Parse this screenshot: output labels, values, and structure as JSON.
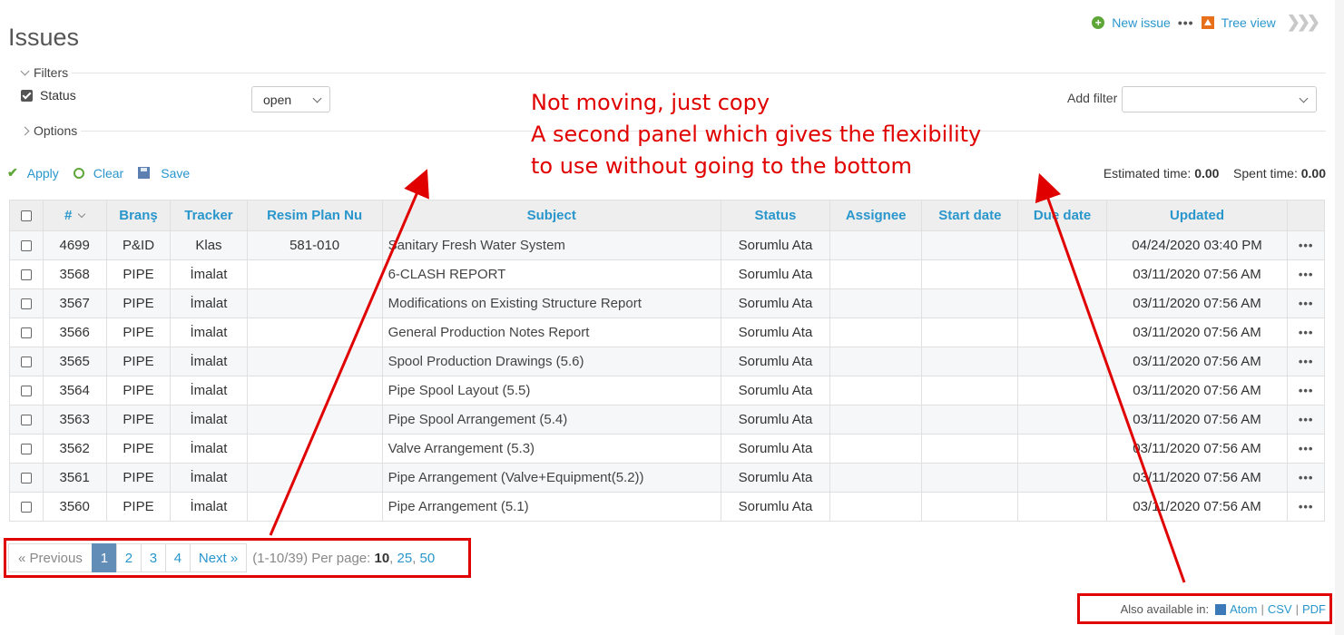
{
  "header": {
    "title": "Issues",
    "new_issue": "New issue",
    "more": "•••",
    "tree_view": "Tree view"
  },
  "filters": {
    "legend": "Filters",
    "status_label": "Status",
    "status_value": "open",
    "add_filter_label": "Add filter",
    "add_filter_value": ""
  },
  "options": {
    "legend": "Options"
  },
  "actions": {
    "apply": "Apply",
    "clear": "Clear",
    "save": "Save"
  },
  "totals": {
    "estimated_label": "Estimated time:",
    "estimated_value": "0.00",
    "spent_label": "Spent time:",
    "spent_value": "0.00"
  },
  "table": {
    "columns": [
      "#",
      "Branş",
      "Tracker",
      "Resim Plan Nu",
      "Subject",
      "Status",
      "Assignee",
      "Start date",
      "Due date",
      "Updated"
    ],
    "rows": [
      {
        "id": "4699",
        "brans": "P&ID",
        "tracker": "Klas",
        "resim": "581-010",
        "subject": "Sanitary Fresh Water System",
        "status": "Sorumlu Ata",
        "assignee": "",
        "start": "",
        "due": "",
        "updated": "04/24/2020 03:40 PM"
      },
      {
        "id": "3568",
        "brans": "PIPE",
        "tracker": "İmalat",
        "resim": "",
        "subject": "6-CLASH REPORT",
        "status": "Sorumlu Ata",
        "assignee": "",
        "start": "",
        "due": "",
        "updated": "03/11/2020 07:56 AM"
      },
      {
        "id": "3567",
        "brans": "PIPE",
        "tracker": "İmalat",
        "resim": "",
        "subject": "Modifications on Existing Structure Report",
        "status": "Sorumlu Ata",
        "assignee": "",
        "start": "",
        "due": "",
        "updated": "03/11/2020 07:56 AM"
      },
      {
        "id": "3566",
        "brans": "PIPE",
        "tracker": "İmalat",
        "resim": "",
        "subject": "General Production Notes Report",
        "status": "Sorumlu Ata",
        "assignee": "",
        "start": "",
        "due": "",
        "updated": "03/11/2020 07:56 AM"
      },
      {
        "id": "3565",
        "brans": "PIPE",
        "tracker": "İmalat",
        "resim": "",
        "subject": "Spool Production Drawings (5.6)",
        "status": "Sorumlu Ata",
        "assignee": "",
        "start": "",
        "due": "",
        "updated": "03/11/2020 07:56 AM"
      },
      {
        "id": "3564",
        "brans": "PIPE",
        "tracker": "İmalat",
        "resim": "",
        "subject": "Pipe Spool Layout (5.5)",
        "status": "Sorumlu Ata",
        "assignee": "",
        "start": "",
        "due": "",
        "updated": "03/11/2020 07:56 AM"
      },
      {
        "id": "3563",
        "brans": "PIPE",
        "tracker": "İmalat",
        "resim": "",
        "subject": "Pipe Spool Arrangement (5.4)",
        "status": "Sorumlu Ata",
        "assignee": "",
        "start": "",
        "due": "",
        "updated": "03/11/2020 07:56 AM"
      },
      {
        "id": "3562",
        "brans": "PIPE",
        "tracker": "İmalat",
        "resim": "",
        "subject": "Valve Arrangement (5.3)",
        "status": "Sorumlu Ata",
        "assignee": "",
        "start": "",
        "due": "",
        "updated": "03/11/2020 07:56 AM"
      },
      {
        "id": "3561",
        "brans": "PIPE",
        "tracker": "İmalat",
        "resim": "",
        "subject": "Pipe Arrangement (Valve+Equipment(5.2))",
        "status": "Sorumlu Ata",
        "assignee": "",
        "start": "",
        "due": "",
        "updated": "03/11/2020 07:56 AM"
      },
      {
        "id": "3560",
        "brans": "PIPE",
        "tracker": "İmalat",
        "resim": "",
        "subject": "Pipe Arrangement (5.1)",
        "status": "Sorumlu Ata",
        "assignee": "",
        "start": "",
        "due": "",
        "updated": "03/11/2020 07:56 AM"
      }
    ]
  },
  "pagination": {
    "previous": "« Previous",
    "pages": [
      "1",
      "2",
      "3",
      "4"
    ],
    "current": "1",
    "next": "Next »",
    "info": "(1-10/39) Per page:",
    "per_page_current": "10",
    "per_page_options": [
      "25",
      "50"
    ]
  },
  "formats": {
    "label": "Also available in:",
    "atom": "Atom",
    "csv": "CSV",
    "pdf": "PDF",
    "sep": "|"
  },
  "annotation": {
    "line1": "Not moving, just copy",
    "line2": "A second panel which gives the flexibility",
    "line3": "to use without going to the bottom",
    "color": "#e00000"
  },
  "colors": {
    "link": "#2996cc",
    "current_page": "#628db6",
    "header_bg": "#eeeeee"
  }
}
